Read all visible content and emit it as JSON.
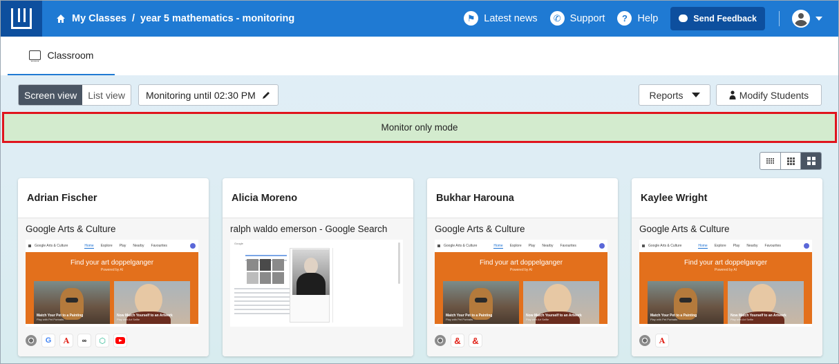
{
  "header": {
    "breadcrumb": [
      "My Classes",
      "year 5 mathematics - monitoring"
    ],
    "breadcrumb_sep": "/",
    "links": [
      {
        "label": "Latest news",
        "icon": "megaphone-icon"
      },
      {
        "label": "Support",
        "icon": "phone-icon"
      },
      {
        "label": "Help",
        "icon": "question-icon"
      }
    ],
    "feedback_label": "Send Feedback"
  },
  "tabs": [
    {
      "label": "Classroom",
      "icon": "classroom-icon",
      "active": true
    }
  ],
  "toolbar": {
    "view_options": [
      "Screen view",
      "List view"
    ],
    "active_view": "Screen view",
    "monitoring_label": "Monitoring until 02:30 PM",
    "reports_label": "Reports",
    "modify_label": "Modify Students"
  },
  "banner": {
    "text": "Monitor only mode",
    "bg": "#d3ebce",
    "border": "#e0141d"
  },
  "students": [
    {
      "name": "Adrian Fischer",
      "tab_title": "Google Arts & Culture",
      "screen": "arts",
      "extensions": [
        "chrome",
        "google",
        "adobe",
        "abc",
        "cube",
        "youtube"
      ]
    },
    {
      "name": "Alicia Moreno",
      "tab_title": "ralph waldo emerson - Google Search",
      "screen": "search",
      "extensions": []
    },
    {
      "name": "Bukhar Harouna",
      "tab_title": "Google Arts & Culture",
      "screen": "arts",
      "extensions": [
        "chrome",
        "amp",
        "amp"
      ]
    },
    {
      "name": "Kaylee Wright",
      "tab_title": "Google Arts & Culture",
      "screen": "arts",
      "extensions": [
        "chrome",
        "adobe"
      ]
    }
  ],
  "arts_screen": {
    "site": "Google Arts & Culture",
    "nav": [
      "Home",
      "Explore",
      "Play",
      "Nearby",
      "Favourites"
    ],
    "hero_title": "Find your art doppelganger",
    "hero_sub": "Powered by AI",
    "art1_caption": "Match Your Pet to a Painting",
    "art1_sub": "Play with Pet Portraits",
    "art2_caption": "Now Match Yourself to an Artwork",
    "art2_sub": "Play with Art Selfie"
  },
  "search_screen": {
    "logo": "Google"
  },
  "colors": {
    "topbar": "#1f7ad3",
    "accent_dark": "#0d4f9e",
    "hero": "#e3701c"
  }
}
